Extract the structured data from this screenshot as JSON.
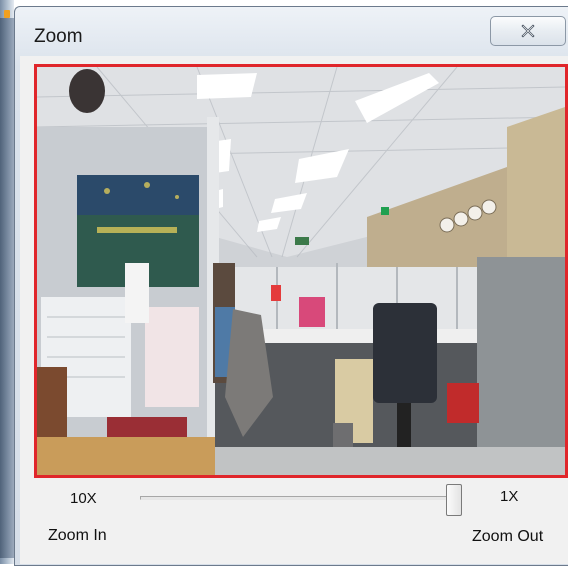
{
  "window": {
    "title": "Zoom",
    "background_title": "",
    "close_icon": "close-x-icon"
  },
  "camera": {
    "osd_left": "",
    "osd_right": "",
    "frame_color": "#e0262b"
  },
  "zoom": {
    "max_label": "10X",
    "min_label": "1X",
    "zoom_in_label": "Zoom In",
    "zoom_out_label": "Zoom Out",
    "level_fraction_toward_zoom_out": 0.98
  }
}
